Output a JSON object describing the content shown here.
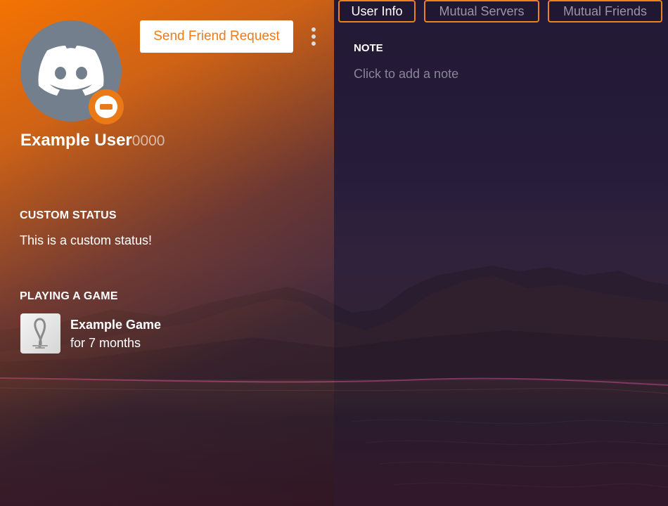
{
  "profile": {
    "username": "Example User",
    "discriminator": "0000",
    "avatar_icon": "discord-logo-icon",
    "status_icon": "do-not-disturb-icon",
    "send_friend_request_label": "Send Friend Request",
    "more_icon": "kebab-menu-icon"
  },
  "custom_status": {
    "heading": "CUSTOM STATUS",
    "text": "This is a custom status!"
  },
  "activity": {
    "heading": "PLAYING A GAME",
    "game_name": "Example Game",
    "duration": "for 7 months",
    "icon": "game-icon"
  },
  "tabs": [
    {
      "label": "User Info",
      "active": true
    },
    {
      "label": "Mutual Servers",
      "active": false
    },
    {
      "label": "Mutual Friends",
      "active": false
    }
  ],
  "note": {
    "heading": "NOTE",
    "placeholder": "Click to add a note"
  },
  "colors": {
    "accent": "#f47a14",
    "avatar_bg": "#747f8d",
    "background": "#2a1f38"
  }
}
